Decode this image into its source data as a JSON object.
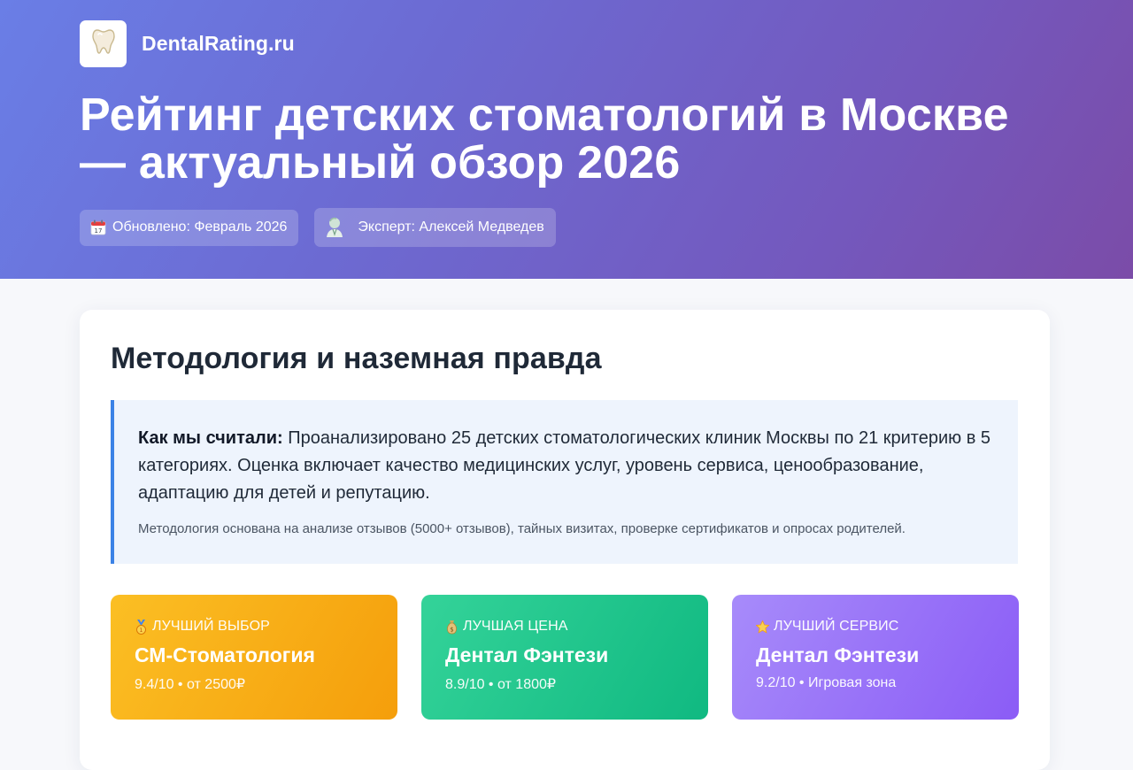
{
  "site": {
    "name": "DentalRating.ru",
    "logo_icon": "tooth-icon"
  },
  "hero": {
    "title": "Рейтинг детских стоматологий в Москве — актуальный обзор 2026",
    "updated_label": "Обновлено: Февраль 2026",
    "updated_icon": "calendar-icon",
    "expert_label": "Эксперт: Алексей Медведев",
    "expert_icon": "expert-avatar-icon"
  },
  "methodology": {
    "title": "Методология и наземная правда",
    "lead": "Как мы считали:",
    "text": "Проанализировано 25 детских стоматологических клиник Москвы по 21 критерию в 5 категориях. Оценка включает качество медицинских услуг, уровень сервиса, ценообразование, адаптацию для детей и репутацию.",
    "note": "Методология основана на анализе отзывов (5000+ отзывов), тайных визитах, проверке сертификатов и опросах родителей."
  },
  "awards": [
    {
      "icon": "medal-icon",
      "label": "ЛУЧШИЙ ВЫБОР",
      "name": "СМ-Стоматология",
      "meta": "9.4/10 • от 2500₽",
      "color": "#f59e0b"
    },
    {
      "icon": "money-bag-icon",
      "label": "ЛУЧШАЯ ЦЕНА",
      "name": "Дентал Фэнтези",
      "meta": "8.9/10 • от 1800₽",
      "color": "#10b981"
    },
    {
      "icon": "star-icon",
      "label": "ЛУЧШИЙ СЕРВИС",
      "name": "Дентал Фэнтези",
      "meta": "9.2/10 • Игровая зона",
      "color": "#8b5cf6"
    }
  ],
  "colors": {
    "hero_start": "#6a7ee6",
    "hero_end": "#7b4ca8",
    "accent_blue": "#3b82e6",
    "method_bg": "#eef4fd"
  }
}
